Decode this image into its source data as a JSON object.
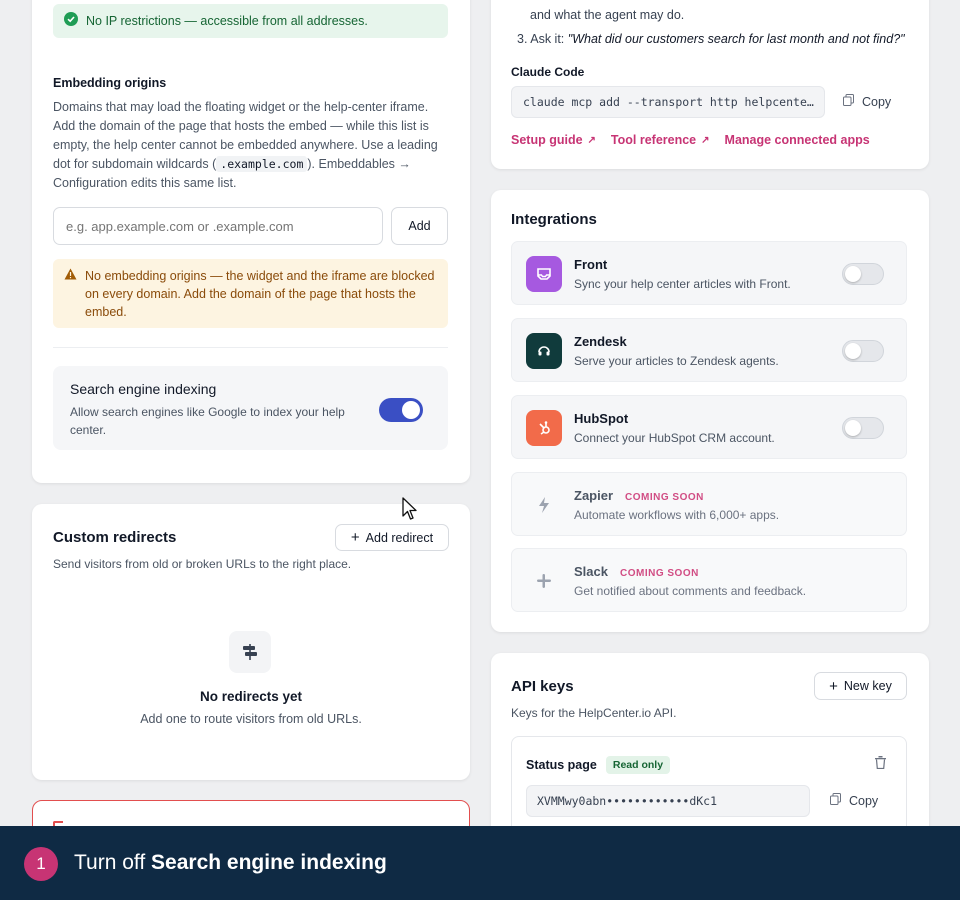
{
  "colors": {
    "accent": "#3a4fc4",
    "link": "#c73474",
    "success_bg": "#e7f5ec",
    "warning_bg": "#fdf4e1",
    "banner_bg": "#0f2a44"
  },
  "ip": {
    "notice": "No IP restrictions — accessible from all addresses."
  },
  "embedding": {
    "title": "Embedding origins",
    "desc_1": "Domains that may load the floating widget or the help-center iframe. Add the domain of the page that hosts the embed — while this list is empty, the help center cannot be embedded anywhere. Use a leading dot for subdomain wildcards (",
    "desc_code": ".example.com",
    "desc_2": "). Embeddables → Configuration edits this same list.",
    "placeholder": "e.g. app.example.com or .example.com",
    "add_label": "Add",
    "warning": "No embedding origins — the widget and the iframe are blocked on every domain. Add the domain of the page that hosts the embed."
  },
  "indexing": {
    "title": "Search engine indexing",
    "desc": "Allow search engines like Google to index your help center.",
    "enabled": true
  },
  "redirects": {
    "title": "Custom redirects",
    "add_label": "Add redirect",
    "desc": "Send visitors from old or broken URLs to the right place.",
    "empty_title": "No redirects yet",
    "empty_desc": "Add one to route visitors from old URLs."
  },
  "mcp": {
    "step2_text": "and what the agent may do.",
    "step3_num": "3.",
    "step3_prefix": "Ask it:",
    "step3_quote": "\"What did our customers search for last month and not find?\"",
    "claude_label": "Claude Code",
    "command": "claude mcp add --transport http helpcente…",
    "copy_label": "Copy",
    "links": [
      "Setup guide",
      "Tool reference",
      "Manage connected apps"
    ]
  },
  "integrations": {
    "title": "Integrations",
    "items": [
      {
        "name": "Front",
        "desc": "Sync your help center articles with Front.",
        "icon": "front-icon",
        "color": "#a659e0"
      },
      {
        "name": "Zendesk",
        "desc": "Serve your articles to Zendesk agents.",
        "icon": "zendesk-icon",
        "color": "#103b3c"
      },
      {
        "name": "HubSpot",
        "desc": "Connect your HubSpot CRM account.",
        "icon": "hubspot-icon",
        "color": "#f26b4a"
      },
      {
        "name": "Zapier",
        "desc": "Automate workflows with 6,000+ apps.",
        "icon": "bolt-icon",
        "badge": "COMING SOON"
      },
      {
        "name": "Slack",
        "desc": "Get notified about comments and feedback.",
        "icon": "slack-icon",
        "badge": "COMING SOON"
      }
    ]
  },
  "api": {
    "title": "API keys",
    "new_label": "New key",
    "desc": "Keys for the HelpCenter.io API.",
    "key_name": "Status page",
    "key_badge": "Read only",
    "key_value": "XVMMwy0abn••••••••••••dKc1",
    "copy_label": "Copy"
  },
  "banner": {
    "step": "1",
    "prefix": "Turn off ",
    "target": "Search engine indexing"
  }
}
